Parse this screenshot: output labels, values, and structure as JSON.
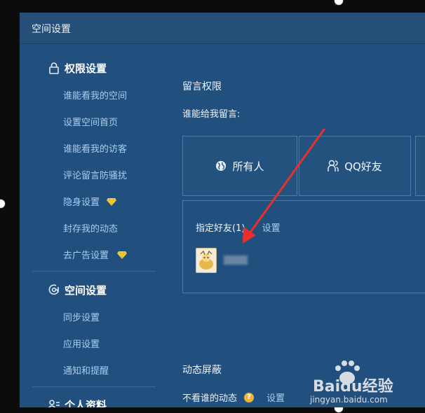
{
  "window": {
    "title": "空间设置"
  },
  "sidebar": {
    "permissions_header": "权限设置",
    "permissions_items": [
      {
        "label": "谁能看我的空间",
        "vip": false
      },
      {
        "label": "设置空间首页",
        "vip": false
      },
      {
        "label": "谁能看我的访客",
        "vip": false
      },
      {
        "label": "评论留言防骚扰",
        "vip": false
      },
      {
        "label": "隐身设置",
        "vip": true
      },
      {
        "label": "封存我的动态",
        "vip": false
      },
      {
        "label": "去广告设置",
        "vip": true
      }
    ],
    "space_header": "空间设置",
    "space_items": [
      {
        "label": "同步设置"
      },
      {
        "label": "应用设置"
      },
      {
        "label": "通知和提醒"
      }
    ],
    "profile_header": "个人资料"
  },
  "main": {
    "comment_section_title": "留言权限",
    "who_can_comment": "谁能给我留言:",
    "options": [
      {
        "label": "所有人",
        "icon": "globe-icon"
      },
      {
        "label": "QQ好友",
        "icon": "friends-icon"
      }
    ],
    "specified_friends_label": "指定好友(1)",
    "settings_link": "设置",
    "feed_block_title": "动态屏蔽",
    "hide_feed_label": "不看谁的动态",
    "help_mark": "?",
    "hide_feed_settings_link": "设置"
  },
  "watermark": {
    "brand": "Baidu经验",
    "url": "jingyan.baidu.com"
  },
  "colors": {
    "arrow": "#e8302a",
    "vip_gem": "#f3d23a",
    "link": "#a9cdf0"
  }
}
